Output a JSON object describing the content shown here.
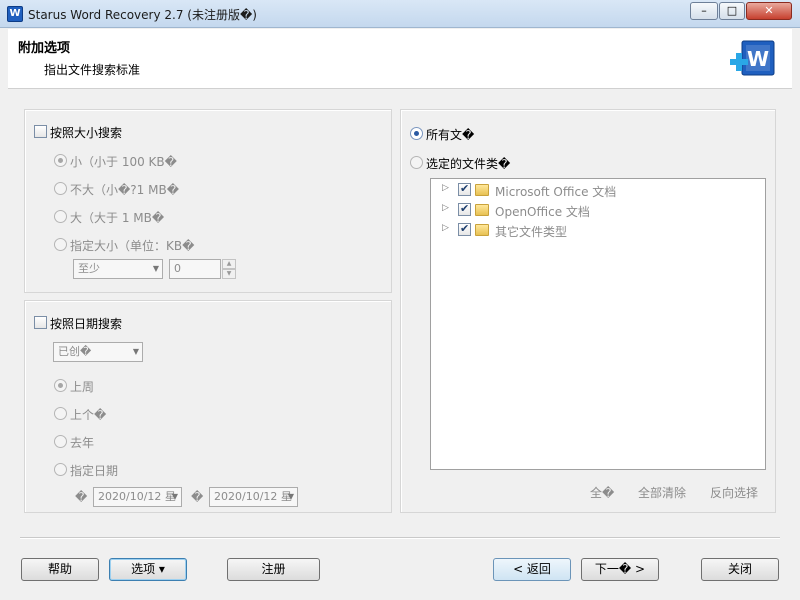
{
  "window": {
    "title": "Starus Word Recovery 2.7 (未注册版�)",
    "app_icon": "W",
    "minimize": "–",
    "maximize": "□",
    "close": "✕"
  },
  "header": {
    "title": "附加选项",
    "subtitle": "指出文件搜索标准",
    "logo_letter": "W"
  },
  "size_panel": {
    "checkbox_label": "按照大小搜索",
    "options": [
      "小（小于 100 KB�",
      "不大（小�?1 MB�",
      "大（大于 1 MB�",
      "指定大小（单位：KB�"
    ],
    "comparator": "至少",
    "amount": "0"
  },
  "date_panel": {
    "checkbox_label": "按照日期搜索",
    "date_type": "已创�",
    "options": [
      "上周",
      "上个�",
      "去年",
      "指定日期"
    ],
    "from_marker": "�",
    "from_date": "2020/10/12 星",
    "to_marker": "�",
    "to_date": "2020/10/12 星"
  },
  "folders_panel": {
    "all_files_label": "所有文�",
    "selected_types_label": "选定的文件类�",
    "tree_items": [
      "Microsoft Office 文档",
      "OpenOffice 文档",
      "其它文件类型"
    ],
    "select_all": "全�",
    "clear_all": "全部清除",
    "invert": "反向选择"
  },
  "buttons": {
    "help": "帮助",
    "options": "选项 ▾",
    "register": "注册",
    "back": "< 返回",
    "next": "下一� >",
    "close": "关闭"
  }
}
